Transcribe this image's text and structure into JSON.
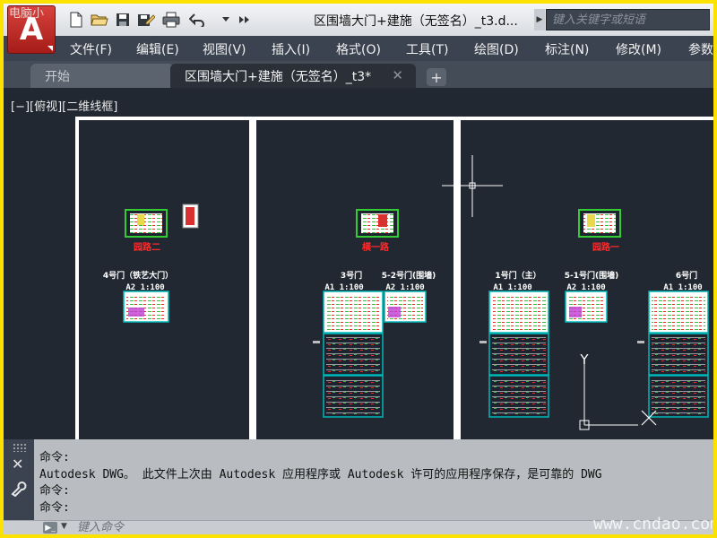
{
  "titlebar": {
    "watermark": "电脑小",
    "logo_letter": "A",
    "document_title": "区围墙大门+建施（无签名）_t3.d...",
    "search_placeholder": "键入关键字或短语",
    "quick_access": [
      "new-icon",
      "open-icon",
      "save-icon",
      "save-as-icon",
      "print-icon",
      "undo-icon",
      "dropdown-icon",
      "more-icon"
    ]
  },
  "menubar": {
    "items": [
      "文件(F)",
      "编辑(E)",
      "视图(V)",
      "插入(I)",
      "格式(O)",
      "工具(T)",
      "绘图(D)",
      "标注(N)",
      "修改(M)",
      "参数"
    ]
  },
  "tabs": {
    "start": "开始",
    "drawing": "区围墙大门+建施（无签名）_t3*",
    "close_glyph": "✕",
    "new_glyph": "+"
  },
  "viewport": {
    "label": "[−][俯视][二维线框]"
  },
  "drawing": {
    "panels": [
      {
        "section_label": "园路二",
        "sheets": [
          {
            "title": "4号门（铁艺大门）",
            "scale": "A2 1:100"
          }
        ]
      },
      {
        "section_label": "横一路",
        "sheets": [
          {
            "title": "3号门",
            "scale": "A1 1:100"
          },
          {
            "title": "5-2号门(围墙)",
            "scale": "A2 1:100"
          }
        ]
      },
      {
        "section_label": "园路一",
        "sheets": [
          {
            "title": "1号门（主）",
            "scale": "A1 1:100"
          },
          {
            "title": "5-1号门(围墙)",
            "scale": "A2 1:100"
          },
          {
            "title": "6号门",
            "scale": "A1 1:100"
          }
        ]
      }
    ],
    "ucs_axis_label": "Y",
    "colors": {
      "sheet_border": "#00b7b7",
      "section_label": "#ff2a2a",
      "frame": "#ffffff",
      "green_frame": "#33cc33"
    }
  },
  "command": {
    "history": [
      "命令:",
      "Autodesk DWG。  此文件上次由 Autodesk 应用程序或 Autodesk 许可的应用程序保存，是可靠的 DWG",
      "命令:",
      "命令:"
    ],
    "input_placeholder": "键入命令",
    "close_glyph": "✕",
    "prompt_icon_glyph": "▶_"
  },
  "watermark": "www.cndao.com"
}
